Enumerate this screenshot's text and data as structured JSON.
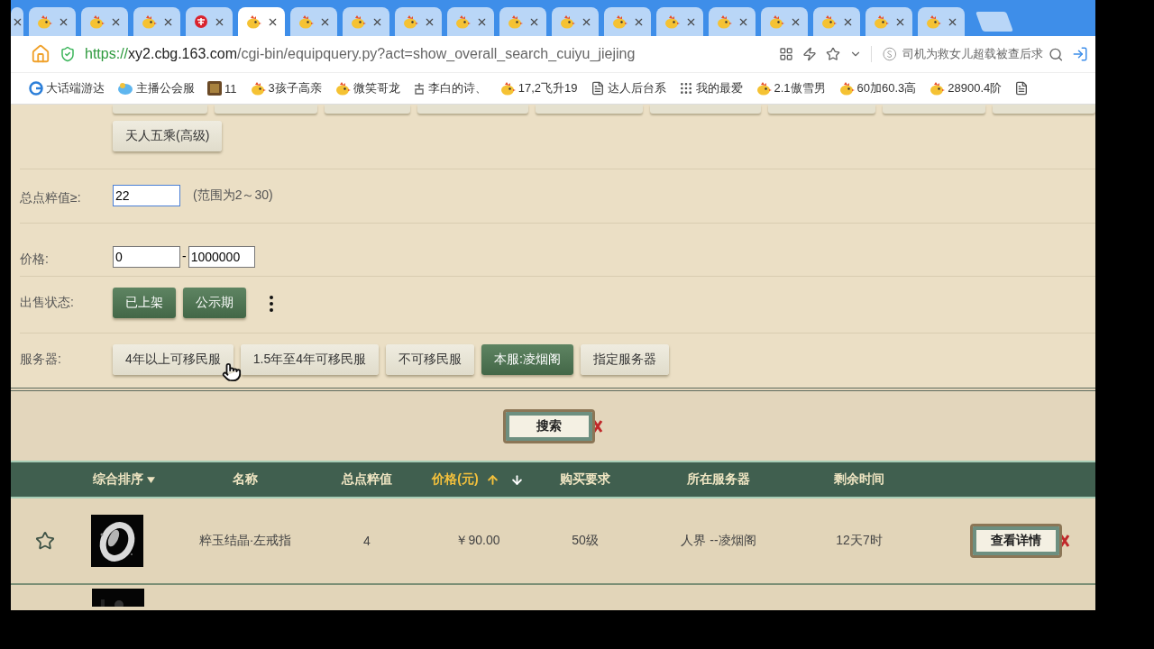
{
  "tabs": [
    {
      "kind": "cut",
      "selected": false
    },
    {
      "kind": "chick",
      "selected": false
    },
    {
      "kind": "chick",
      "selected": false
    },
    {
      "kind": "chick",
      "selected": false
    },
    {
      "kind": "seal",
      "selected": false
    },
    {
      "kind": "chick",
      "selected": true
    },
    {
      "kind": "chick",
      "selected": false
    },
    {
      "kind": "chick",
      "selected": false
    },
    {
      "kind": "chick",
      "selected": false
    },
    {
      "kind": "chick",
      "selected": false
    },
    {
      "kind": "chick",
      "selected": false
    },
    {
      "kind": "chick",
      "selected": false
    },
    {
      "kind": "chick",
      "selected": false
    },
    {
      "kind": "chick",
      "selected": false
    },
    {
      "kind": "chick",
      "selected": false
    },
    {
      "kind": "chick",
      "selected": false
    },
    {
      "kind": "chick",
      "selected": false
    },
    {
      "kind": "chick",
      "selected": false
    },
    {
      "kind": "chick",
      "selected": false
    }
  ],
  "address_bar": {
    "scheme": "https://",
    "host": "xy2.cbg.163.com",
    "path": "/cgi-bin/equipquery.py?act=show_overall_search_cuiyu_jiejing"
  },
  "search_box": {
    "value": "司机为救女儿超载被查后求"
  },
  "bookmarks": [
    {
      "kind": "globe",
      "label": "大话端游达"
    },
    {
      "kind": "cloud",
      "label": "主播公会服"
    },
    {
      "kind": "tile",
      "label": "11"
    },
    {
      "kind": "chick",
      "label": "3孩子高亲"
    },
    {
      "kind": "chick",
      "label": "微笑哥龙"
    },
    {
      "kind": "glyph",
      "label": "李白的诗、"
    },
    {
      "kind": "chick",
      "label": "17,2飞升19"
    },
    {
      "kind": "doc",
      "label": "达人后台系"
    },
    {
      "kind": "grid",
      "label": "我的最爱"
    },
    {
      "kind": "chick",
      "label": "2.1傲雪男"
    },
    {
      "kind": "chick",
      "label": "60加60.3高"
    },
    {
      "kind": "chick",
      "label": "28900.4阶"
    },
    {
      "kind": "doc"
    }
  ],
  "level_option": {
    "label": "天人五乘(高级)"
  },
  "filters": {
    "score": {
      "label": "总点粹值≥:",
      "value": "22",
      "focused": true,
      "hint": "(范围为2～30)"
    },
    "price": {
      "label": "价格:",
      "min": "0",
      "separator": "-",
      "max": "1000000"
    },
    "sale_status": {
      "label": "出售状态:",
      "options": [
        {
          "label": "已上架",
          "selected": true
        },
        {
          "label": "公示期",
          "selected": true
        }
      ]
    },
    "server": {
      "label": "服务器:",
      "options": [
        {
          "label": "4年以上可移民服",
          "selected": false
        },
        {
          "label": "1.5年至4年可移民服",
          "selected": false
        },
        {
          "label": "不可移民服",
          "selected": false
        },
        {
          "label": "本服:凌烟阁",
          "selected": true
        },
        {
          "label": "指定服务器",
          "selected": false
        }
      ]
    }
  },
  "search_button": {
    "label": "搜索"
  },
  "table": {
    "columns": [
      {
        "kind": "sort",
        "label": "综合排序",
        "selected": false
      },
      {
        "kind": "plain",
        "label": "名称",
        "selected": false
      },
      {
        "kind": "plain",
        "label": "总点粹值",
        "selected": false
      },
      {
        "kind": "price",
        "label": "价格(元)",
        "selected": true
      },
      {
        "kind": "plain",
        "label": "购买要求",
        "selected": false
      },
      {
        "kind": "plain",
        "label": "所在服务器",
        "selected": false
      },
      {
        "kind": "plain",
        "label": "剩余时间",
        "selected": false
      }
    ],
    "rows": [
      {
        "name": "粹玉结晶·左戒指",
        "score": "4",
        "price": "￥90.00",
        "requirement": "50级",
        "server": "人界 --凌烟阁",
        "time_left": "12天7时",
        "action": "查看详情"
      }
    ]
  }
}
